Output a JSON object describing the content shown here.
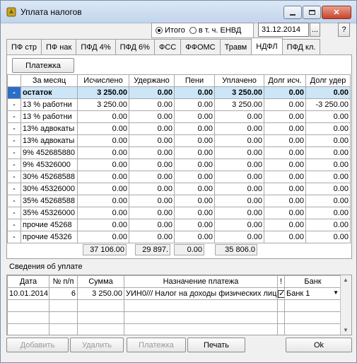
{
  "window": {
    "title": "Уплата налогов"
  },
  "filter": {
    "option_total": "Итого",
    "option_envd": "в т. ч. ЕНВД",
    "selected": "Итого",
    "date": "31.12.2014",
    "browse_label": "...",
    "help_label": "?"
  },
  "tabs": [
    "ПФ стр",
    "ПФ нак",
    "ПФД 4%",
    "ПФД 6%",
    "ФСС",
    "ФФОМС",
    "Травм",
    "НДФЛ",
    "ПФД кл."
  ],
  "active_tab": "НДФЛ",
  "payments_button": "Платежка",
  "main_table": {
    "columns": [
      "За месяц",
      "Исчислено",
      "Удержано",
      "Пени",
      "Уплачено",
      "Долг исч.",
      "Долг удер"
    ],
    "rows": [
      {
        "ind": "-",
        "month": "остаток",
        "calc": "3 250.00",
        "withheld": "0.00",
        "penalty": "0.00",
        "paid": "3 250.00",
        "debt_calc": "0.00",
        "debt_with": "0.00"
      },
      {
        "ind": "-",
        "month": "13 % работни",
        "calc": "3 250.00",
        "withheld": "0.00",
        "penalty": "0.00",
        "paid": "3 250.00",
        "debt_calc": "0.00",
        "debt_with": "-3 250.00"
      },
      {
        "ind": "-",
        "month": "13 % работни",
        "calc": "0.00",
        "withheld": "0.00",
        "penalty": "0.00",
        "paid": "0.00",
        "debt_calc": "0.00",
        "debt_with": "0.00"
      },
      {
        "ind": "-",
        "month": "13% адвокаты",
        "calc": "0.00",
        "withheld": "0.00",
        "penalty": "0.00",
        "paid": "0.00",
        "debt_calc": "0.00",
        "debt_with": "0.00"
      },
      {
        "ind": "-",
        "month": "13% адвокаты",
        "calc": "0.00",
        "withheld": "0.00",
        "penalty": "0.00",
        "paid": "0.00",
        "debt_calc": "0.00",
        "debt_with": "0.00"
      },
      {
        "ind": "-",
        "month": "9% 452685880",
        "calc": "0.00",
        "withheld": "0.00",
        "penalty": "0.00",
        "paid": "0.00",
        "debt_calc": "0.00",
        "debt_with": "0.00"
      },
      {
        "ind": "-",
        "month": "9% 45326000",
        "calc": "0.00",
        "withheld": "0.00",
        "penalty": "0.00",
        "paid": "0.00",
        "debt_calc": "0.00",
        "debt_with": "0.00"
      },
      {
        "ind": "-",
        "month": "30% 45268588",
        "calc": "0.00",
        "withheld": "0.00",
        "penalty": "0.00",
        "paid": "0.00",
        "debt_calc": "0.00",
        "debt_with": "0.00"
      },
      {
        "ind": "-",
        "month": "30% 45326000",
        "calc": "0.00",
        "withheld": "0.00",
        "penalty": "0.00",
        "paid": "0.00",
        "debt_calc": "0.00",
        "debt_with": "0.00"
      },
      {
        "ind": "-",
        "month": "35% 45268588",
        "calc": "0.00",
        "withheld": "0.00",
        "penalty": "0.00",
        "paid": "0.00",
        "debt_calc": "0.00",
        "debt_with": "0.00"
      },
      {
        "ind": "-",
        "month": "35% 45326000",
        "calc": "0.00",
        "withheld": "0.00",
        "penalty": "0.00",
        "paid": "0.00",
        "debt_calc": "0.00",
        "debt_with": "0.00"
      },
      {
        "ind": "-",
        "month": "прочие 45268",
        "calc": "0.00",
        "withheld": "0.00",
        "penalty": "0.00",
        "paid": "0.00",
        "debt_calc": "0.00",
        "debt_with": "0.00"
      },
      {
        "ind": "-",
        "month": "прочие 45326",
        "calc": "0.00",
        "withheld": "0.00",
        "penalty": "0.00",
        "paid": "0.00",
        "debt_calc": "0.00",
        "debt_with": "0.00"
      }
    ],
    "totals": {
      "calc": "37 106.00",
      "withheld": "29 897.",
      "penalty": "0.00",
      "paid": "35 806.0"
    }
  },
  "payments_section": {
    "label": "Сведения об уплате",
    "columns": [
      "Дата",
      "№ п/п",
      "Сумма",
      "Назначение платежа",
      "!",
      "Банк"
    ],
    "rows": [
      {
        "date": "10.01.2014",
        "num": "6",
        "sum": "3 250.00",
        "purpose": "УИН0/// Налог на доходы физических лиц",
        "flag": true,
        "bank": "Банк 1"
      }
    ]
  },
  "bottom_buttons": {
    "add": "Добавить",
    "delete": "Удалить",
    "payment": "Платежка",
    "print": "Печать",
    "ok": "Ok"
  }
}
